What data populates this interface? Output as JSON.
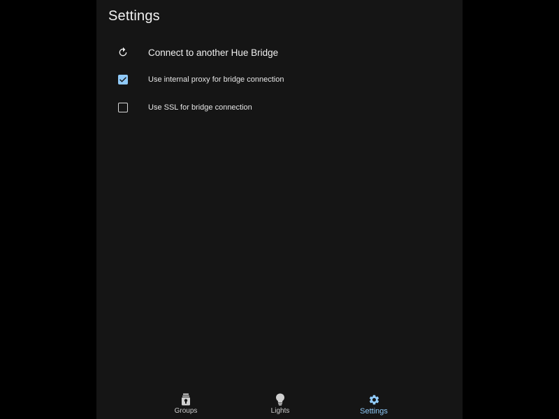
{
  "colors": {
    "background": "#151515",
    "outer": "#000000",
    "accent": "#90caf9",
    "text": "#e6e6e6"
  },
  "header": {
    "title": "Settings"
  },
  "settings": {
    "items": [
      {
        "label": "Connect to another Hue Bridge",
        "icon": "refresh-icon"
      },
      {
        "label": "Use internal proxy for bridge connection",
        "checked": true,
        "icon": "checkbox-checked-icon"
      },
      {
        "label": "Use SSL for bridge connection",
        "checked": false,
        "icon": "checkbox-unchecked-icon"
      }
    ]
  },
  "nav": {
    "tabs": [
      {
        "label": "Groups",
        "icon": "lamp-icon",
        "active": false
      },
      {
        "label": "Lights",
        "icon": "lightbulb-icon",
        "active": false
      },
      {
        "label": "Settings",
        "icon": "gear-icon",
        "active": true
      }
    ]
  }
}
